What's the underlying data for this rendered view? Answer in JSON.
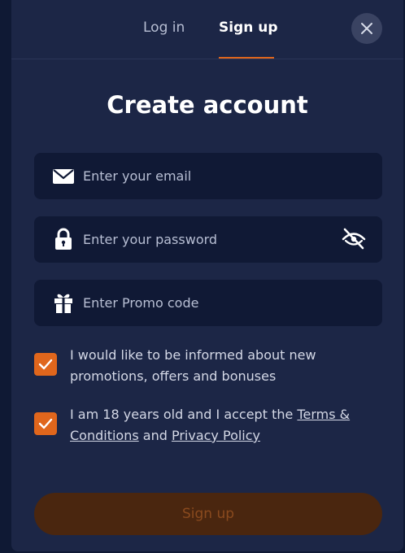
{
  "tabs": {
    "login": "Log in",
    "signup": "Sign up"
  },
  "title": "Create account",
  "fields": {
    "email_placeholder": "Enter your email",
    "password_placeholder": "Enter your password",
    "promo_placeholder": "Enter Promo code"
  },
  "checks": {
    "news_text": "I would like to be informed about new promotions, offers and bonuses",
    "news_checked": true,
    "terms_prefix": "I am 18 years old and I accept the ",
    "terms_link": "Terms & Conditions",
    "terms_and": " and ",
    "privacy_link": "Privacy Policy",
    "terms_checked": true
  },
  "submit_label": "Sign up",
  "colors": {
    "accent": "#e0661c",
    "modal_bg": "#1c2646",
    "field_bg": "#101935",
    "button_disabled_bg": "#4a260f",
    "button_disabled_text": "#8a4a1e"
  },
  "icons": {
    "close": "close-icon",
    "email": "envelope-icon",
    "password": "lock-icon",
    "toggle": "eye-slash-icon",
    "promo": "gift-icon",
    "check": "checkmark-icon"
  }
}
